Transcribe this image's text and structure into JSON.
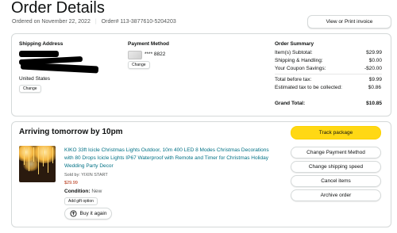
{
  "page": {
    "title": "Order Details",
    "ordered_on": "Ordered on November 22, 2022",
    "separator": "|",
    "order_number": "Order# 113-3877610-5204203",
    "invoice_button": "View or Print invoice"
  },
  "shipping_address": {
    "heading": "Shipping Address",
    "country": "United States",
    "change_button": "Change"
  },
  "payment": {
    "heading": "Payment Method",
    "card_digits": "**** 8822",
    "change_button": "Change",
    "card_icon": "credit-card-icon"
  },
  "summary": {
    "heading": "Order Summary",
    "rows": [
      {
        "label": "Item(s) Subtotal:",
        "value": "$29.99"
      },
      {
        "label": "Shipping & Handling:",
        "value": "$0.00"
      },
      {
        "label": "Your Coupon Savings:",
        "value": "-$20.00"
      },
      {
        "label": "Total before tax:",
        "value": "$9.99"
      },
      {
        "label": "Estimated tax to be collected:",
        "value": "$0.86"
      },
      {
        "label": "Grand Total:",
        "value": "$10.85"
      }
    ]
  },
  "shipment": {
    "arrival": "Arriving tomorrow by 10pm",
    "product_title": "KIKO 33ft Icicle Christmas Lights Outdoor, 10m 400 LED 8 Modes Christmas Decorations with 80 Drops Icicle Lights IP67 Waterproof with Remote and Timer for Christmas Holiday Wedding Party Decor",
    "sold_by": "Sold by: YIXIN START",
    "price": "$29.99",
    "condition_label": "Condition:",
    "condition_value": "New",
    "gift_button": "Add gift option",
    "buy_again_button": "Buy it again",
    "buy_again_icon": "refresh-cart-icon"
  },
  "actions": {
    "track": "Track package",
    "buttons": [
      "Change Payment Method",
      "Change shipping speed",
      "Cancel items",
      "Archive order"
    ]
  },
  "colors": {
    "accent_yellow": "#ffd814",
    "link_teal": "#007185",
    "price_red": "#b12704",
    "border": "#d5d9d9"
  }
}
